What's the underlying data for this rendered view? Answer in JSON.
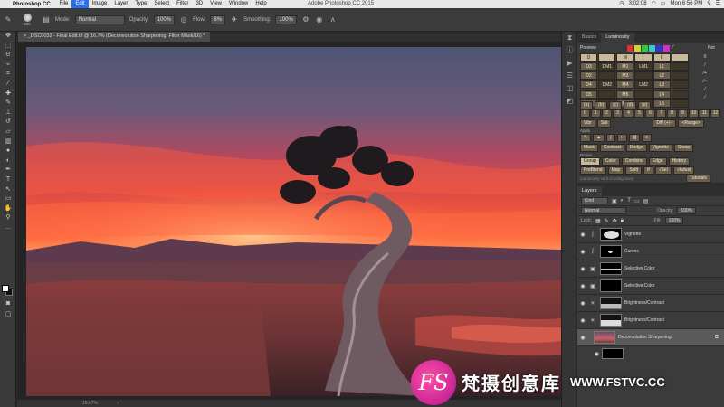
{
  "menubar": {
    "app": "Photoshop CC",
    "items": [
      "File",
      "Edit",
      "Image",
      "Layer",
      "Type",
      "Select",
      "Filter",
      "3D",
      "View",
      "Window",
      "Help"
    ],
    "active_item": "Edit",
    "window_title": "Adobe Photoshop CC 2015",
    "clock": "3:02:08",
    "datetime": "Mon 6:56 PM"
  },
  "options": {
    "brush_size": "206",
    "mode_label": "Mode:",
    "mode_value": "Normal",
    "opacity_label": "Opacity:",
    "opacity_value": "100%",
    "flow_label": "Flow:",
    "flow_value": "8%",
    "smoothing_label": "Smoothing:",
    "smoothing_value": "100%"
  },
  "document": {
    "tab_title": "_DSC0032 - Final Edit.tif @ 16.7% (Deconvolution Sharpening, Filter Mask/16) *",
    "zoom": "16.7%"
  },
  "panels": {
    "top_tabs": [
      "Basics",
      "Luminosity"
    ],
    "active_top_tab": "Luminosity",
    "luminosity": {
      "preview_label": "Preview",
      "not_label": "Not",
      "grid_rows": [
        [
          "D",
          "",
          "M",
          "",
          "L",
          ""
        ],
        [
          "D3",
          "DM1",
          "M1",
          "LM1",
          "L1",
          ""
        ],
        [
          "D2",
          "",
          "M3",
          "",
          "L2",
          ""
        ],
        [
          "D4",
          "DM2",
          "M4",
          "LM2",
          "L3",
          ""
        ],
        [
          "D5",
          "",
          "M5",
          "",
          "L4",
          ""
        ],
        [
          "D6",
          "",
          "M6",
          "",
          "L5",
          ""
        ]
      ],
      "letters": [
        "(a)",
        "(b)",
        "(c)",
        "(d)",
        "(e)"
      ],
      "numbers": [
        "0",
        "1",
        "2",
        "3",
        "4",
        "5",
        "6",
        "7",
        "8",
        "9",
        "10",
        "11",
        "12"
      ],
      "vibr_label": "Vibr",
      "sat_label": "Sat",
      "diff_label": "Diff (+/-)",
      "range_label": "<Range>",
      "apply_label": "Apply",
      "buttons_row1": [
        "Mask",
        "Contrast",
        "Dodge",
        "Vignette",
        "Sharp"
      ],
      "refine_label": "Refine",
      "buttons_row2": [
        "Group",
        "Color",
        "Combine",
        "Edge",
        "History"
      ],
      "buttons_row3": [
        "PreBlend",
        "Map",
        "Split",
        "If",
        "√Sel",
        "√Adust"
      ],
      "footer": "Luminosity v4.0.0 Using Sony",
      "tutorials_label": "Tutorials"
    },
    "layers": {
      "title": "Layers",
      "kind_label": "Kind",
      "blend_mode": "Normal",
      "opacity_label": "Opacity:",
      "opacity_value": "100%",
      "lock_label": "Lock:",
      "fill_label": "Fill:",
      "fill_value": "100%",
      "list": [
        {
          "name": "Vignette",
          "type": "adj-curves"
        },
        {
          "name": "Curves",
          "type": "adj-curves"
        },
        {
          "name": "Selective Color",
          "type": "adj-selective"
        },
        {
          "name": "Selective Color",
          "type": "adj-selective"
        },
        {
          "name": "Brightness/Contrast",
          "type": "adj-bright"
        },
        {
          "name": "Brightness/Contrast",
          "type": "adj-bright"
        },
        {
          "name": "Deconvolution Sharpening",
          "type": "smart-object"
        }
      ]
    }
  },
  "status": {
    "zoom": "16.67%"
  },
  "watermark": {
    "logo_text": "FS",
    "chinese_text": "梵摄创意库",
    "url": "WWW.FSTVC.CC"
  },
  "colors": {
    "accent_blue": "#2a6ee8",
    "panel_bg": "#3b3b3b",
    "lum_button": "#6a5e4c",
    "watermark_pink": "#d11a9a"
  }
}
